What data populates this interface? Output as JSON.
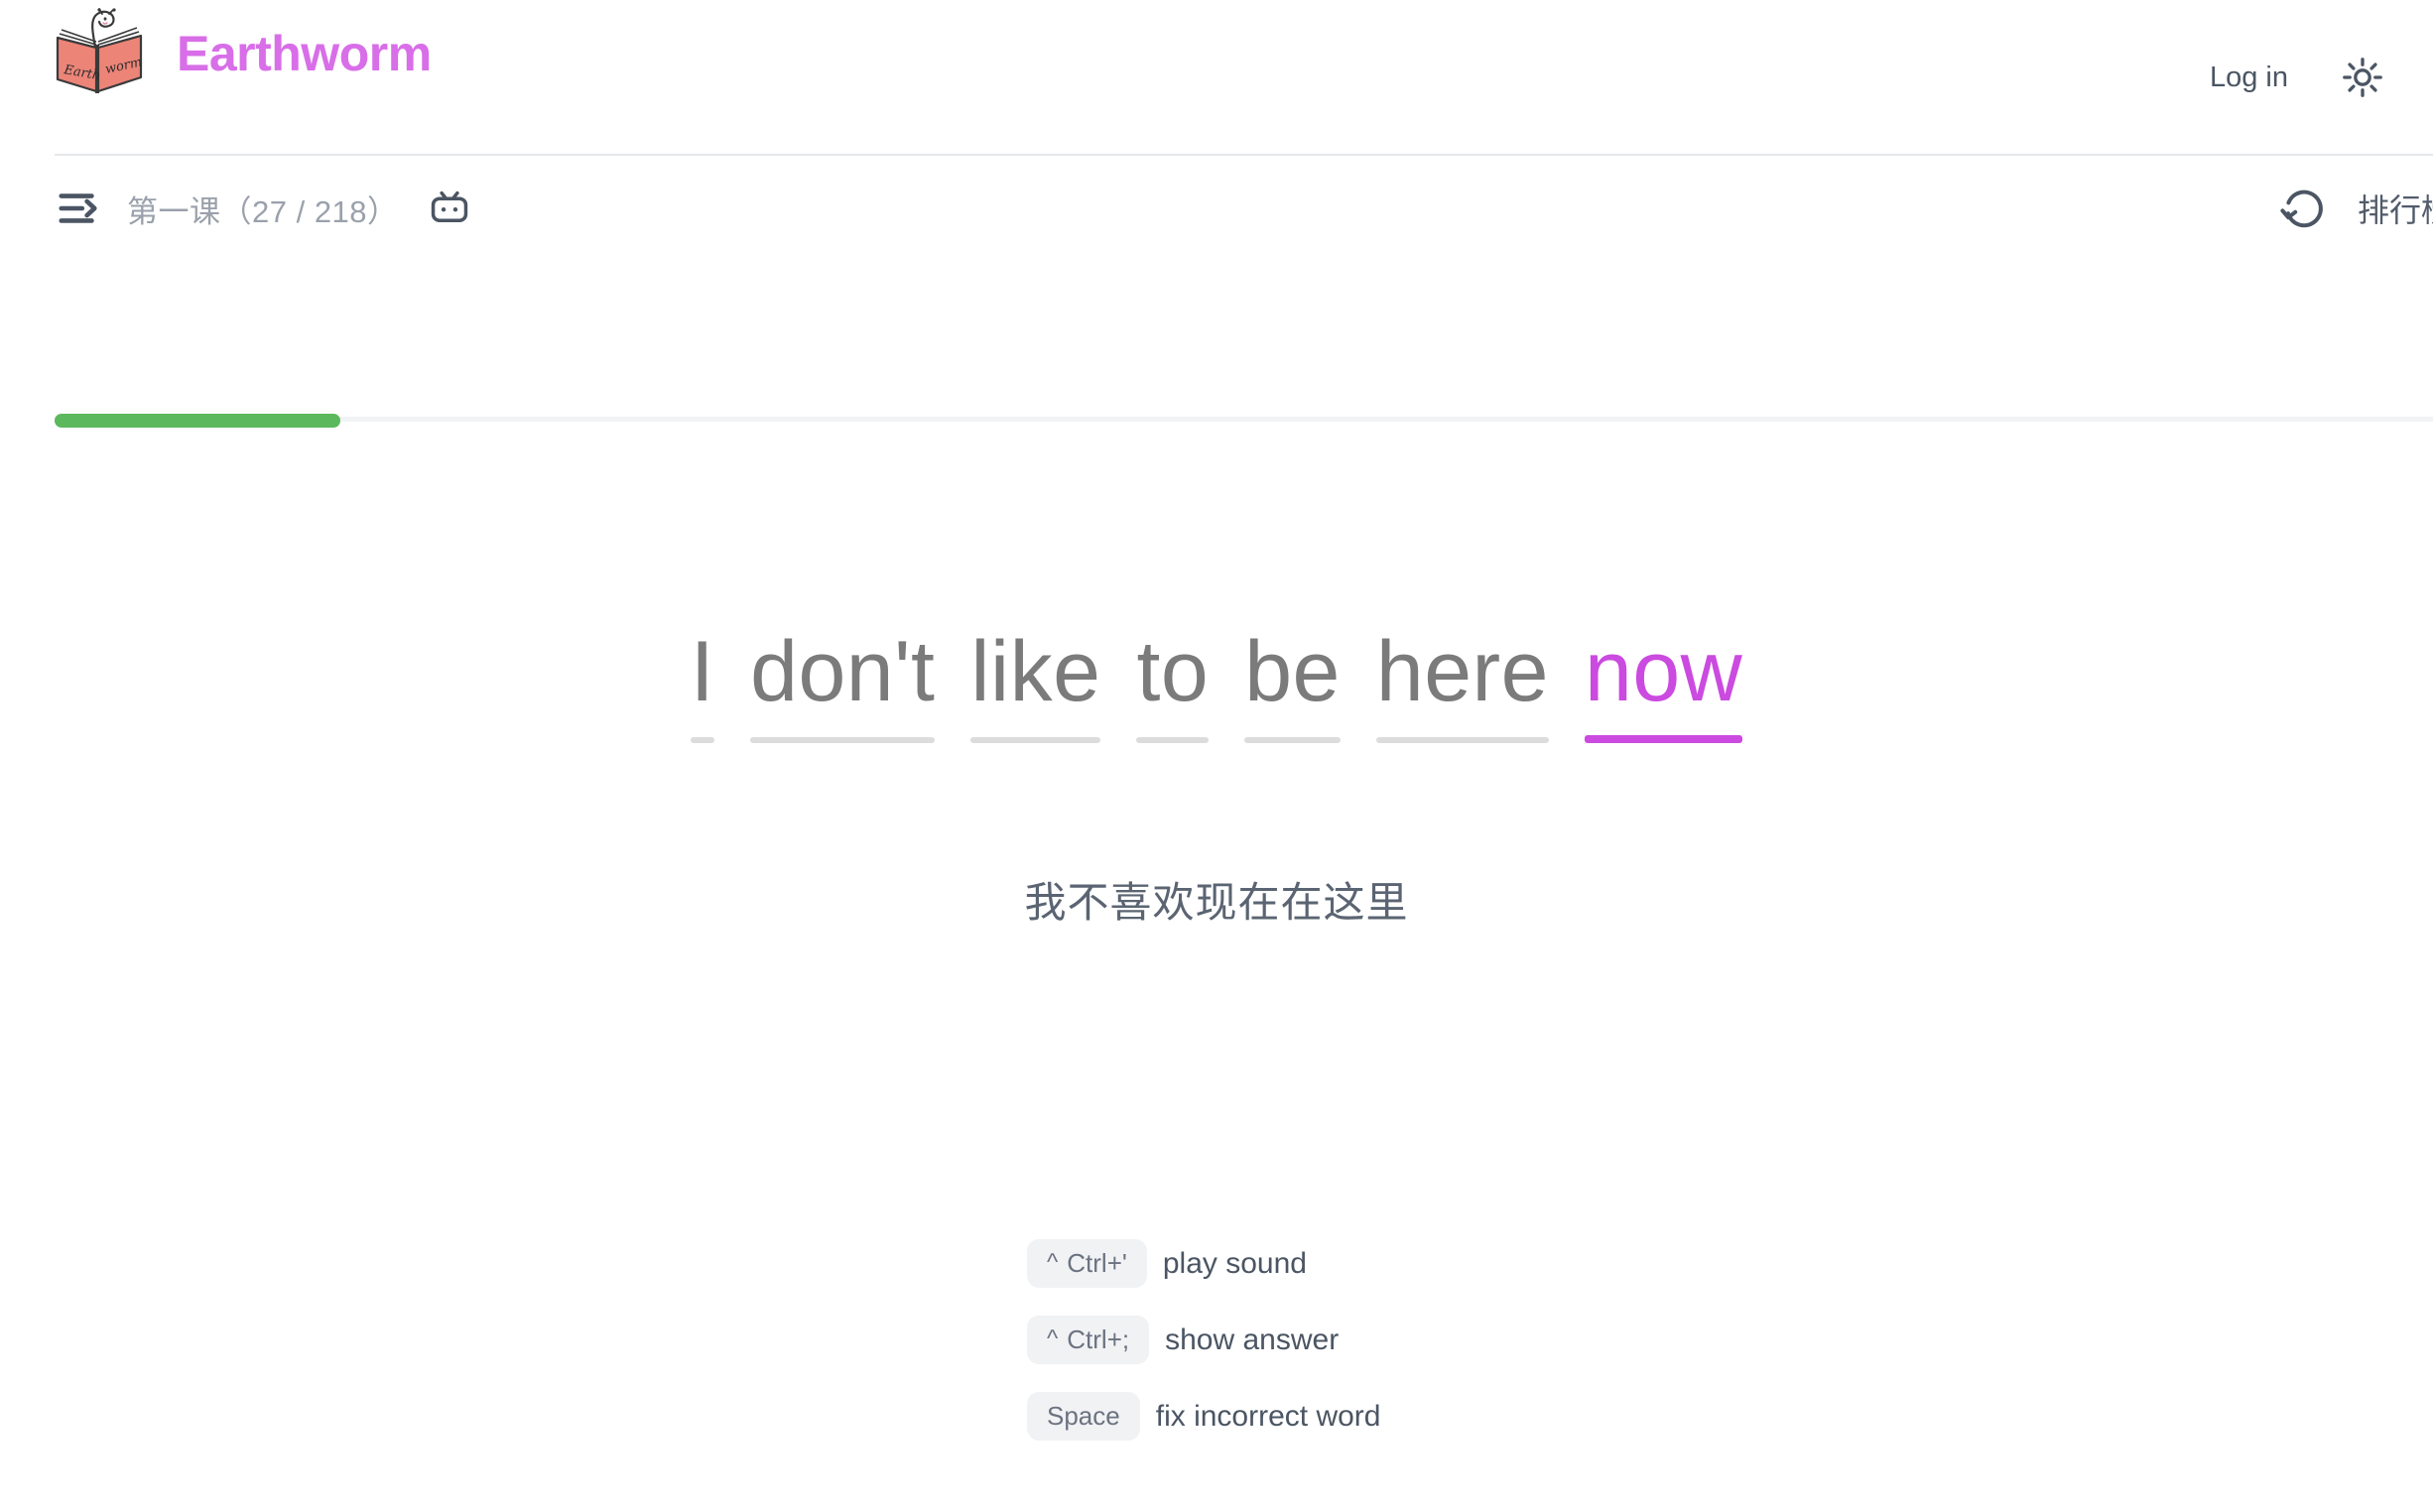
{
  "header": {
    "brand_name": "Earthworm",
    "logo_icon": "earthworm-book-logo",
    "login_label": "Log in",
    "theme_icon": "sun-icon"
  },
  "toolbar": {
    "menu_icon": "menu-arrow-icon",
    "lesson_label": "第一课（27 / 218）",
    "bilibili_icon": "bilibili-tv-icon",
    "reset_icon": "rotate-ccw-icon",
    "leaderboard_label": "排行榜",
    "progress_percent": 12
  },
  "exercise": {
    "words": [
      {
        "text": "I",
        "state": "done"
      },
      {
        "text": "don't",
        "state": "done"
      },
      {
        "text": "like",
        "state": "done"
      },
      {
        "text": "to",
        "state": "done"
      },
      {
        "text": "be",
        "state": "done"
      },
      {
        "text": "here",
        "state": "done"
      },
      {
        "text": "now",
        "state": "active"
      }
    ],
    "translation": "我不喜欢现在在这里"
  },
  "shortcuts": [
    {
      "modifier": "^",
      "key": "Ctrl+'",
      "description": "play sound"
    },
    {
      "modifier": "^",
      "key": "Ctrl+;",
      "description": "show answer"
    },
    {
      "modifier": "",
      "key": "Space",
      "description": "fix incorrect word"
    }
  ],
  "colors": {
    "brand": "#d86ee8",
    "active_word": "#cb4ae0",
    "progress": "#5cb85c",
    "word": "#7b7b7b"
  }
}
